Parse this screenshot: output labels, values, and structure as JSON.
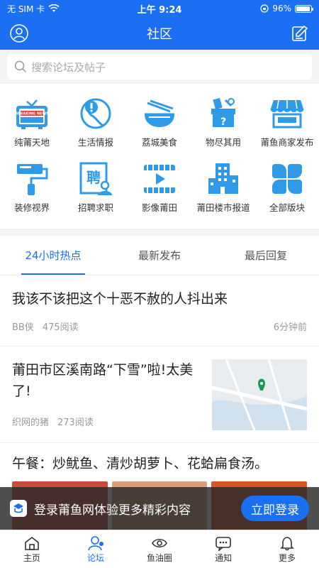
{
  "status": {
    "carrier": "无 SIM 卡",
    "time": "上午 9:24",
    "battery": "96%",
    "battery_level": 0.96
  },
  "nav": {
    "title": "社区"
  },
  "search": {
    "placeholder": "搜索论坛及帖子"
  },
  "categories": [
    {
      "label": "纯莆天地",
      "icon": "news-tv-icon"
    },
    {
      "label": "生活情报",
      "icon": "alert-globe-icon"
    },
    {
      "label": "荔城美食",
      "icon": "noodle-bowl-icon"
    },
    {
      "label": "物尽其用",
      "icon": "mystery-box-icon"
    },
    {
      "label": "莆鱼商家发布",
      "icon": "storefront-icon"
    },
    {
      "label": "装修视界",
      "icon": "paint-roller-icon"
    },
    {
      "label": "招聘求职",
      "icon": "job-card-icon"
    },
    {
      "label": "影像莆田",
      "icon": "video-player-icon"
    },
    {
      "label": "莆田楼市报道",
      "icon": "building-icon"
    },
    {
      "label": "全部版块",
      "icon": "all-sections-icon"
    }
  ],
  "news_badge": "BREAKING NEWS",
  "job_char": "聘",
  "tabs": [
    "24小时热点",
    "最新发布",
    "最后回复"
  ],
  "posts": [
    {
      "title": "我该不该把这个十恶不赦的人抖出来",
      "author": "BB侠",
      "reads": "475阅读",
      "time": "6分钟前"
    },
    {
      "title": "莆田市区溪南路“下雪”啦!太美了!",
      "author": "织网的猪",
      "reads": "273阅读"
    },
    {
      "title": "午餐：炒鱿鱼、清炒胡萝卜、花蛤扁食汤。"
    }
  ],
  "banner": {
    "text": "登录莆鱼网体验更多精彩内容",
    "button": "立即登录"
  },
  "tabbar": [
    "主页",
    "论坛",
    "鱼油圈",
    "通知",
    "更多"
  ],
  "colors": {
    "brand": "#1a6ff2",
    "icon_blue": "#2f9be8"
  }
}
